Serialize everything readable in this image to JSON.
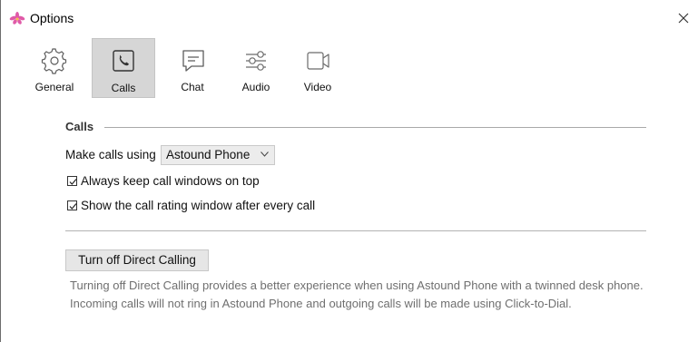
{
  "window": {
    "title": "Options"
  },
  "tabs": [
    {
      "label": "General",
      "icon": "gear-icon"
    },
    {
      "label": "Calls",
      "icon": "phone-icon",
      "active": true
    },
    {
      "label": "Chat",
      "icon": "chat-icon"
    },
    {
      "label": "Audio",
      "icon": "sliders-icon"
    },
    {
      "label": "Video",
      "icon": "video-camera-icon"
    }
  ],
  "calls": {
    "section_title": "Calls",
    "make_calls_label": "Make calls using",
    "make_calls_value": "Astound Phone",
    "checkboxes": [
      {
        "label": "Always keep call windows on top",
        "checked": true
      },
      {
        "label": "Show the call rating window after every call",
        "checked": true
      }
    ],
    "direct_calling_button": "Turn off Direct Calling",
    "direct_calling_desc": "Turning off Direct Calling provides a better experience when using Astound Phone with a twinned desk phone. Incoming calls will not ring in Astound Phone and outgoing calls will be made using Click-to-Dial."
  },
  "colors": {
    "active_tab_bg": "#d6d6d6",
    "logo_pink": "#e05aa8"
  }
}
